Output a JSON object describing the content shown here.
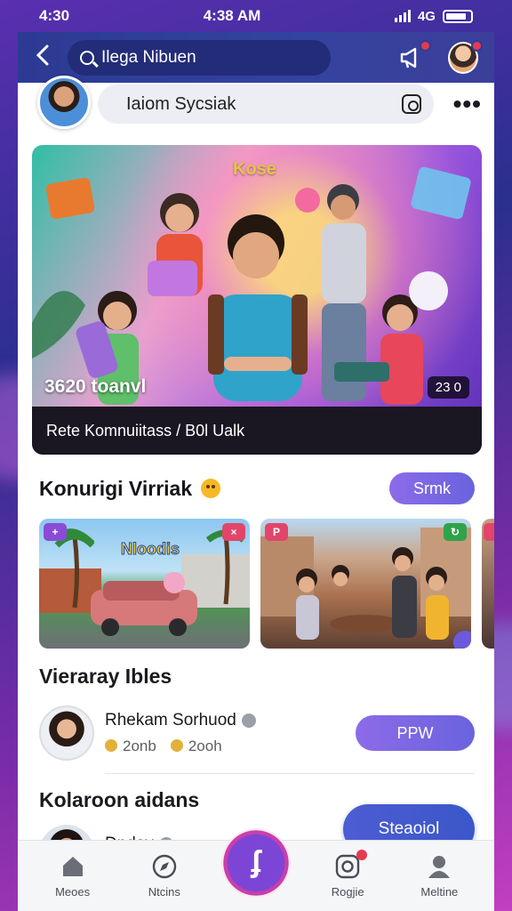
{
  "status_bar": {
    "time_left": "4:30",
    "time_center": "4:38 AM",
    "network": "4G"
  },
  "app_bar": {
    "search_text": "Ilega Nibuen"
  },
  "profile_row": {
    "prompt": "Iaiom Sycsiak"
  },
  "hero": {
    "logo_text": "Kose",
    "count_text": "3620 toanvl",
    "badge_text": "23 0",
    "caption": "Rete Komnuiitass / B0l Ualk"
  },
  "section_community": {
    "title": "Konurigi Virriak",
    "button_label": "Srmk"
  },
  "cards": [
    {
      "title": "Nloodis",
      "tag": "+"
    },
    {
      "title": "",
      "tag": "P"
    }
  ],
  "section_people": {
    "title": "Vieraray Ibles",
    "person": {
      "name": "Rhekam Sorhuod",
      "stat1": "2onb",
      "stat2": "2ooh",
      "button_label": "PPW"
    }
  },
  "section_second": {
    "title": "Kolaroon aidans",
    "person": {
      "name": "Dnday",
      "button_label": "Steaoiol"
    }
  },
  "tabbar": {
    "items": [
      {
        "label": "Meoes",
        "icon": "home-icon"
      },
      {
        "label": "Ntcins",
        "icon": "compass-icon"
      },
      {
        "label": "",
        "icon": "create-icon"
      },
      {
        "label": "Rogjie",
        "icon": "camera-icon"
      },
      {
        "label": "Meltine",
        "icon": "profile-icon"
      }
    ]
  },
  "colors": {
    "accent": "#6a63de",
    "nav": "#2c3a93",
    "badge": "#e53950"
  }
}
